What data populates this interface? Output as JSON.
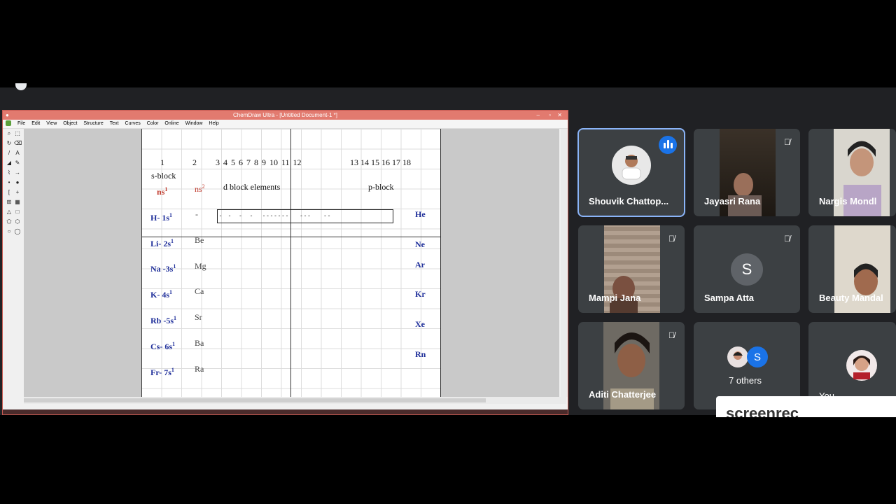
{
  "chemdraw": {
    "title": "ChemDraw Ultra - [Untitled Document-1 *]",
    "menu": [
      "File",
      "Edit",
      "View",
      "Object",
      "Structure",
      "Text",
      "Curves",
      "Color",
      "Online",
      "Window",
      "Help"
    ],
    "groups": {
      "g1": "1",
      "g2": "2",
      "d": "3 4 5 6 7 8 9 10 11 12",
      "p": "13 14 15 16 17 18"
    },
    "sblock": "s-block",
    "ns1": "ns",
    "ns2": "ns",
    "dblock": "d block elements",
    "pblock": "p-block",
    "dashes": " -    -     -     -      - - - - - - -       - - -        - -",
    "g1_elements": [
      "H- 1s",
      "Li- 2s",
      "Na -3s",
      "K- 4s",
      "Rb -5s",
      "Cs- 6s",
      "Fr- 7s"
    ],
    "sup1": "1",
    "sup2": "2",
    "g2_elements": [
      "-",
      "Be",
      "Mg",
      "Ca",
      "Sr",
      "Ba",
      "Ra"
    ],
    "noble": [
      "He",
      "Ne",
      "Ar",
      "Kr",
      "Xe",
      "Rn"
    ]
  },
  "participants": [
    {
      "name": "Shouvik Chattop...",
      "speaking": true
    },
    {
      "name": "Jayasri Rana",
      "muted": true
    },
    {
      "name": "Nargis Mondl",
      "muted": true
    },
    {
      "name": "Mampi Jana",
      "muted": true
    },
    {
      "name": "Sampa Atta",
      "muted": true,
      "initial": "S"
    },
    {
      "name": "Beauty Mandal",
      "muted": true
    },
    {
      "name": "Aditi Chatterjee",
      "muted": true
    },
    {
      "name": "7 others",
      "initial": "S"
    },
    {
      "name": "You"
    }
  ],
  "watermark": "screenrec",
  "colors": {
    "accent": "#8ab4f8",
    "speaking": "#1a73e8",
    "sampa": "#5f6368"
  }
}
